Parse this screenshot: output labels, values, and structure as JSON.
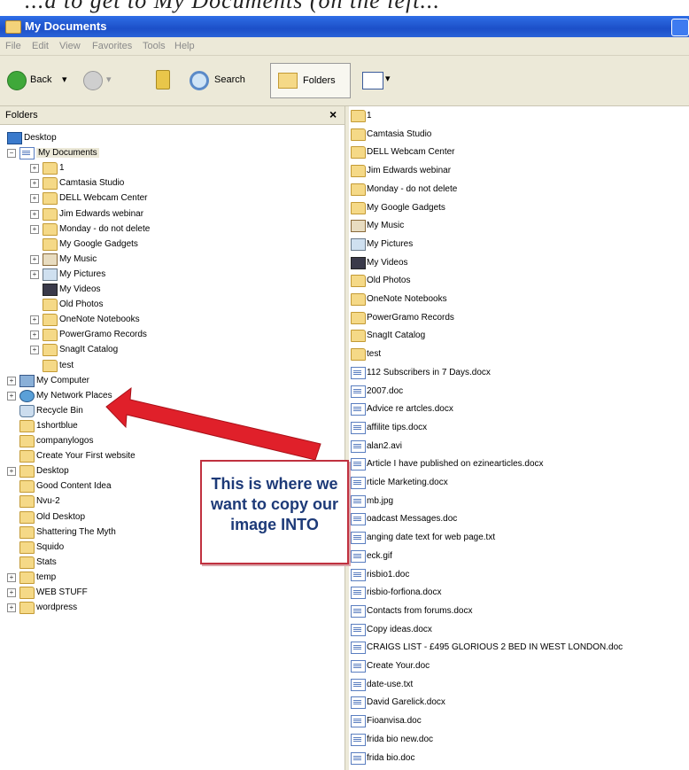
{
  "caption": "...d to get to My Documents (on the left...",
  "window": {
    "title": "My Documents"
  },
  "menu": [
    "File",
    "Edit",
    "View",
    "Favorites",
    "Tools",
    "Help"
  ],
  "toolbar": {
    "back": "Back",
    "search": "Search",
    "folders": "Folders"
  },
  "folders_pane": {
    "title": "Folders",
    "close": "×"
  },
  "tree": [
    {
      "label": "Desktop",
      "indent": 0,
      "icon": "desktop",
      "expander": ""
    },
    {
      "label": "My Documents",
      "indent": 1,
      "icon": "doc-folder",
      "expander": "−"
    },
    {
      "label": "1",
      "indent": 2,
      "icon": "folder",
      "expander": "+"
    },
    {
      "label": "Camtasia Studio",
      "indent": 2,
      "icon": "folder",
      "expander": "+"
    },
    {
      "label": "DELL Webcam Center",
      "indent": 2,
      "icon": "folder",
      "expander": "+"
    },
    {
      "label": "Jim Edwards webinar",
      "indent": 2,
      "icon": "folder",
      "expander": "+"
    },
    {
      "label": "Monday - do not delete",
      "indent": 2,
      "icon": "folder",
      "expander": "+"
    },
    {
      "label": "My Google Gadgets",
      "indent": 2,
      "icon": "folder",
      "expander": ""
    },
    {
      "label": "My Music",
      "indent": 2,
      "icon": "music",
      "expander": "+"
    },
    {
      "label": "My Pictures",
      "indent": 2,
      "icon": "pictures",
      "expander": "+"
    },
    {
      "label": "My Videos",
      "indent": 2,
      "icon": "video",
      "expander": ""
    },
    {
      "label": "Old Photos",
      "indent": 2,
      "icon": "folder",
      "expander": ""
    },
    {
      "label": "OneNote Notebooks",
      "indent": 2,
      "icon": "folder",
      "expander": "+"
    },
    {
      "label": "PowerGramo Records",
      "indent": 2,
      "icon": "folder",
      "expander": "+"
    },
    {
      "label": "SnagIt Catalog",
      "indent": 2,
      "icon": "folder",
      "expander": "+"
    },
    {
      "label": "test",
      "indent": 2,
      "icon": "folder",
      "expander": ""
    },
    {
      "label": "My Computer",
      "indent": 1,
      "icon": "computer",
      "expander": "+"
    },
    {
      "label": "My Network Places",
      "indent": 1,
      "icon": "network",
      "expander": "+"
    },
    {
      "label": "Recycle Bin",
      "indent": 1,
      "icon": "bin",
      "expander": ""
    },
    {
      "label": "1shortblue",
      "indent": 1,
      "icon": "folder",
      "expander": ""
    },
    {
      "label": "companylogos",
      "indent": 1,
      "icon": "folder",
      "expander": ""
    },
    {
      "label": "Create Your First website",
      "indent": 1,
      "icon": "folder",
      "expander": ""
    },
    {
      "label": "Desktop",
      "indent": 1,
      "icon": "folder",
      "expander": "+"
    },
    {
      "label": "Good Content Idea",
      "indent": 1,
      "icon": "folder",
      "expander": ""
    },
    {
      "label": "Nvu-2",
      "indent": 1,
      "icon": "folder",
      "expander": ""
    },
    {
      "label": "Old Desktop",
      "indent": 1,
      "icon": "folder",
      "expander": ""
    },
    {
      "label": "Shattering The Myth",
      "indent": 1,
      "icon": "folder",
      "expander": ""
    },
    {
      "label": "Squido",
      "indent": 1,
      "icon": "folder",
      "expander": ""
    },
    {
      "label": "Stats",
      "indent": 1,
      "icon": "folder",
      "expander": ""
    },
    {
      "label": "temp",
      "indent": 1,
      "icon": "folder",
      "expander": "+"
    },
    {
      "label": "WEB STUFF",
      "indent": 1,
      "icon": "folder",
      "expander": "+"
    },
    {
      "label": "wordpress",
      "indent": 1,
      "icon": "folder",
      "expander": "+"
    }
  ],
  "files": [
    {
      "label": "1",
      "icon": "folder"
    },
    {
      "label": "Camtasia Studio",
      "icon": "folder"
    },
    {
      "label": "DELL Webcam Center",
      "icon": "folder"
    },
    {
      "label": "Jim Edwards webinar",
      "icon": "folder"
    },
    {
      "label": "Monday - do not delete",
      "icon": "folder"
    },
    {
      "label": "My Google Gadgets",
      "icon": "folder"
    },
    {
      "label": "My Music",
      "icon": "music"
    },
    {
      "label": "My Pictures",
      "icon": "pictures"
    },
    {
      "label": "My Videos",
      "icon": "video"
    },
    {
      "label": "Old Photos",
      "icon": "folder"
    },
    {
      "label": "OneNote Notebooks",
      "icon": "folder"
    },
    {
      "label": "PowerGramo Records",
      "icon": "folder"
    },
    {
      "label": "SnagIt Catalog",
      "icon": "folder"
    },
    {
      "label": "test",
      "icon": "folder"
    },
    {
      "label": "112 Subscribers in 7 Days.docx",
      "icon": "doc"
    },
    {
      "label": "2007.doc",
      "icon": "doc"
    },
    {
      "label": "Advice re artcles.docx",
      "icon": "doc"
    },
    {
      "label": "affilite tips.docx",
      "icon": "doc"
    },
    {
      "label": "alan2.avi",
      "icon": "doc"
    },
    {
      "label": "Article I have published on ezinearticles.docx",
      "icon": "doc"
    },
    {
      "label": "rticle Marketing.docx",
      "icon": "doc"
    },
    {
      "label": "mb.jpg",
      "icon": "doc"
    },
    {
      "label": "oadcast Messages.doc",
      "icon": "doc"
    },
    {
      "label": "anging date text for web page.txt",
      "icon": "doc"
    },
    {
      "label": "eck.gif",
      "icon": "doc"
    },
    {
      "label": "risbio1.doc",
      "icon": "doc"
    },
    {
      "label": "risbio-forfiona.docx",
      "icon": "doc"
    },
    {
      "label": "Contacts from forums.docx",
      "icon": "doc"
    },
    {
      "label": "Copy ideas.docx",
      "icon": "doc"
    },
    {
      "label": "CRAIGS LIST - £495 GLORIOUS 2 BED IN WEST LONDON.doc",
      "icon": "doc"
    },
    {
      "label": "Create Your.doc",
      "icon": "doc"
    },
    {
      "label": "date-use.txt",
      "icon": "doc"
    },
    {
      "label": "David Garelick.docx",
      "icon": "doc"
    },
    {
      "label": "Fioanvisa.doc",
      "icon": "doc"
    },
    {
      "label": "frida bio new.doc",
      "icon": "doc"
    },
    {
      "label": "frida bio.doc",
      "icon": "doc"
    }
  ],
  "callout": {
    "text": "This is where we want to copy our image INTO"
  },
  "colors": {
    "titlebar": "#1c4fc8",
    "callout_border": "#c0313f",
    "arrow": "#e0202a",
    "callout_text": "#1d3a78"
  }
}
